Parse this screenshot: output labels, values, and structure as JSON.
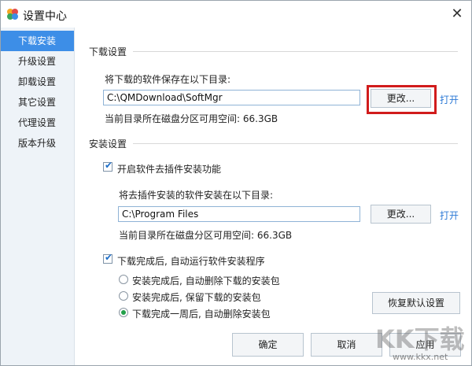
{
  "window": {
    "title": "设置中心"
  },
  "sidebar": {
    "items": [
      {
        "label": "下载安装",
        "active": true
      },
      {
        "label": "升级设置"
      },
      {
        "label": "卸载设置"
      },
      {
        "label": "其它设置"
      },
      {
        "label": "代理设置"
      },
      {
        "label": "版本升级"
      }
    ]
  },
  "download": {
    "section_title": "下载设置",
    "save_label": "将下载的软件保存在以下目录:",
    "path": "C:\\QMDownload\\SoftMgr",
    "change_btn": "更改...",
    "open_link": "打开",
    "space": "当前目录所在磁盘分区可用空间: 66.3GB"
  },
  "install": {
    "section_title": "安装设置",
    "plugin_checkbox": "开启软件去插件安装功能",
    "plugin_checked": true,
    "install_dir_label": "将去插件安装的软件安装在以下目录:",
    "path": "C:\\Program Files",
    "change_btn": "更改...",
    "open_link": "打开",
    "space": "当前目录所在磁盘分区可用空间: 66.3GB",
    "auto_run_checkbox": "下载完成后, 自动运行软件安装程序",
    "auto_run_checked": true,
    "radio_options": [
      {
        "label": "安装完成后, 自动删除下载的安装包",
        "selected": false
      },
      {
        "label": "安装完成后, 保留下载的安装包",
        "selected": false
      },
      {
        "label": "下载完成一周后, 自动删除安装包",
        "selected": true
      }
    ],
    "restore_btn": "恢复默认设置"
  },
  "footer": {
    "ok": "确定",
    "cancel": "取消",
    "apply": "应用"
  },
  "watermark": {
    "text": "KK下载",
    "url": "www.kkx.net"
  },
  "colors": {
    "accent": "#3d8ee7",
    "link": "#2d7ad6",
    "highlight": "#d11c1c"
  }
}
